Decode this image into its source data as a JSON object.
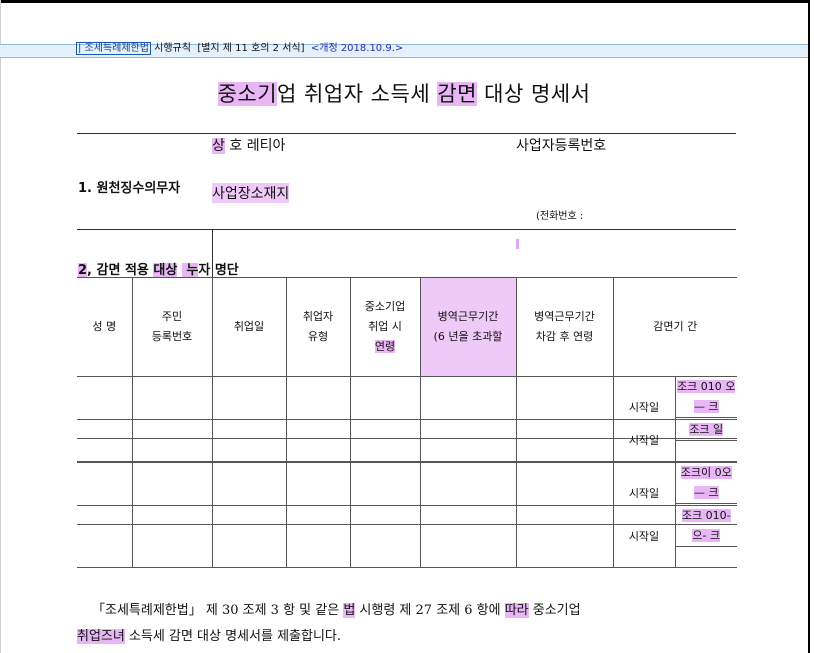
{
  "header": {
    "law_name": "| 조세특례제한법",
    "regulation": "시행규칙",
    "annex": "[별지 제 11 호의 2 서식]",
    "revision_label": "<개정 2018.10.9.>"
  },
  "title": {
    "part1": "중소기",
    "part2": "업",
    "part3": " 취업자 소득세 ",
    "part4": "감면",
    "part5": " 대상 명세서"
  },
  "section1": {
    "label": "1. 원천징수의무자",
    "company_label_hl": "상",
    "company_label_rest": " 호",
    "company_value": "레티아",
    "bizno_label": "사업자등록번호",
    "address_label": "사업장소재지",
    "phone_label": "(전화번호 :"
  },
  "section2": {
    "label_a": "2",
    "label_b": ", 감면 적용 ",
    "label_c": "대상",
    "label_d": " 누",
    "label_e": "자 명단"
  },
  "table": {
    "headers": {
      "name": "성 명",
      "rrn_line1": "주민",
      "rrn_line2": "등록번호",
      "hire_date": "취업일",
      "type_line1": "취업자",
      "type_line2": "유형",
      "age_line1": "중소기업",
      "age_line2": "취업 시",
      "age_line3": "연령",
      "mil_line1": "병역근무기간",
      "mil_line2": "(6 년을 초과할",
      "adj_line1": "병역근무기간",
      "adj_line2": "차감 후 연령",
      "period": "감면기 간"
    },
    "rows": [
      {
        "start_label": "시작일",
        "start_value": "조크 010 오— 크"
      },
      {
        "start_label": "시작일",
        "start_value": "조크 일"
      },
      {
        "start_label": "시작일",
        "start_value": "조크이 0오— 크"
      },
      {
        "start_label": "시작일",
        "start_value": "조크 010-으- 크"
      }
    ]
  },
  "footer": {
    "line1_a": "「조세특례제한법」 제 30 조제 3 항 및 같은 ",
    "line1_b": "법",
    "line1_c": " 시행령 제 27 조제 6 항에 ",
    "line1_d": "따라",
    "line1_e": " 중소기업",
    "line2_a": "취업즈녀",
    "line2_b": " 소득세 감면 대상 명세서를 제출합니다."
  },
  "colors": {
    "highlight": "#e9b6f5",
    "header_band": "#e4f0fa",
    "link_blue": "#2a2ab8"
  }
}
